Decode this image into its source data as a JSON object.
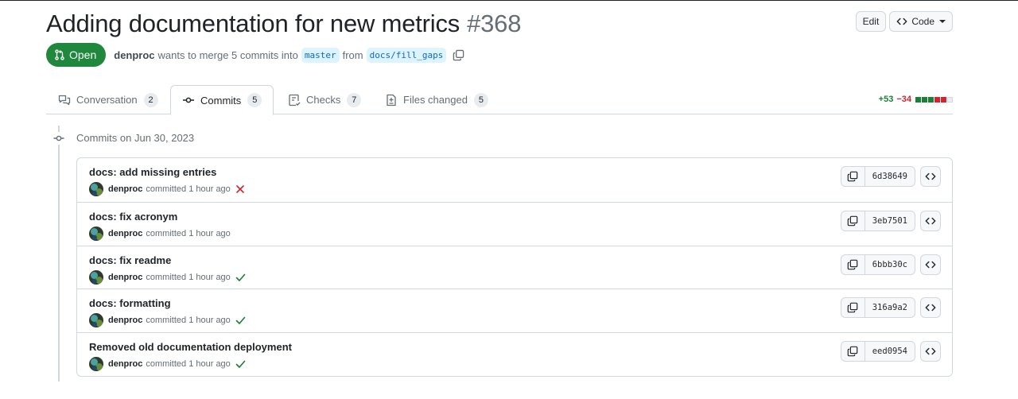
{
  "header": {
    "title": "Adding documentation for new metrics",
    "number": "#368",
    "edit_label": "Edit",
    "code_label": "Code"
  },
  "state": {
    "badge": "Open",
    "author": "denproc",
    "text": "wants to merge 5 commits into",
    "base_branch": "master",
    "from_text": "from",
    "head_branch": "docs/fill_gaps"
  },
  "tabs": [
    {
      "label": "Conversation",
      "count": "2",
      "icon": "comment-discussion-icon"
    },
    {
      "label": "Commits",
      "count": "5",
      "icon": "git-commit-icon"
    },
    {
      "label": "Checks",
      "count": "7",
      "icon": "checklist-icon"
    },
    {
      "label": "Files changed",
      "count": "5",
      "icon": "file-diff-icon"
    }
  ],
  "diffstat": {
    "additions": "+53",
    "deletions": "−34",
    "colors": {
      "add": "#1a7f37",
      "del": "#d1242f",
      "neutral": "#d0d7de"
    }
  },
  "commits_heading": "Commits on Jun 30, 2023",
  "commits": [
    {
      "title": "docs: add missing entries",
      "author": "denproc",
      "meta": "committed 1 hour ago",
      "status": "failure",
      "sha": "6d38649"
    },
    {
      "title": "docs: fix acronym",
      "author": "denproc",
      "meta": "committed 1 hour ago",
      "status": "none",
      "sha": "3eb7501"
    },
    {
      "title": "docs: fix readme",
      "author": "denproc",
      "meta": "committed 1 hour ago",
      "status": "success",
      "sha": "6bbb30c"
    },
    {
      "title": "docs: formatting",
      "author": "denproc",
      "meta": "committed 1 hour ago",
      "status": "success",
      "sha": "316a9a2"
    },
    {
      "title": "Removed old documentation deployment",
      "author": "denproc",
      "meta": "committed 1 hour ago",
      "status": "success",
      "sha": "eed0954"
    }
  ]
}
